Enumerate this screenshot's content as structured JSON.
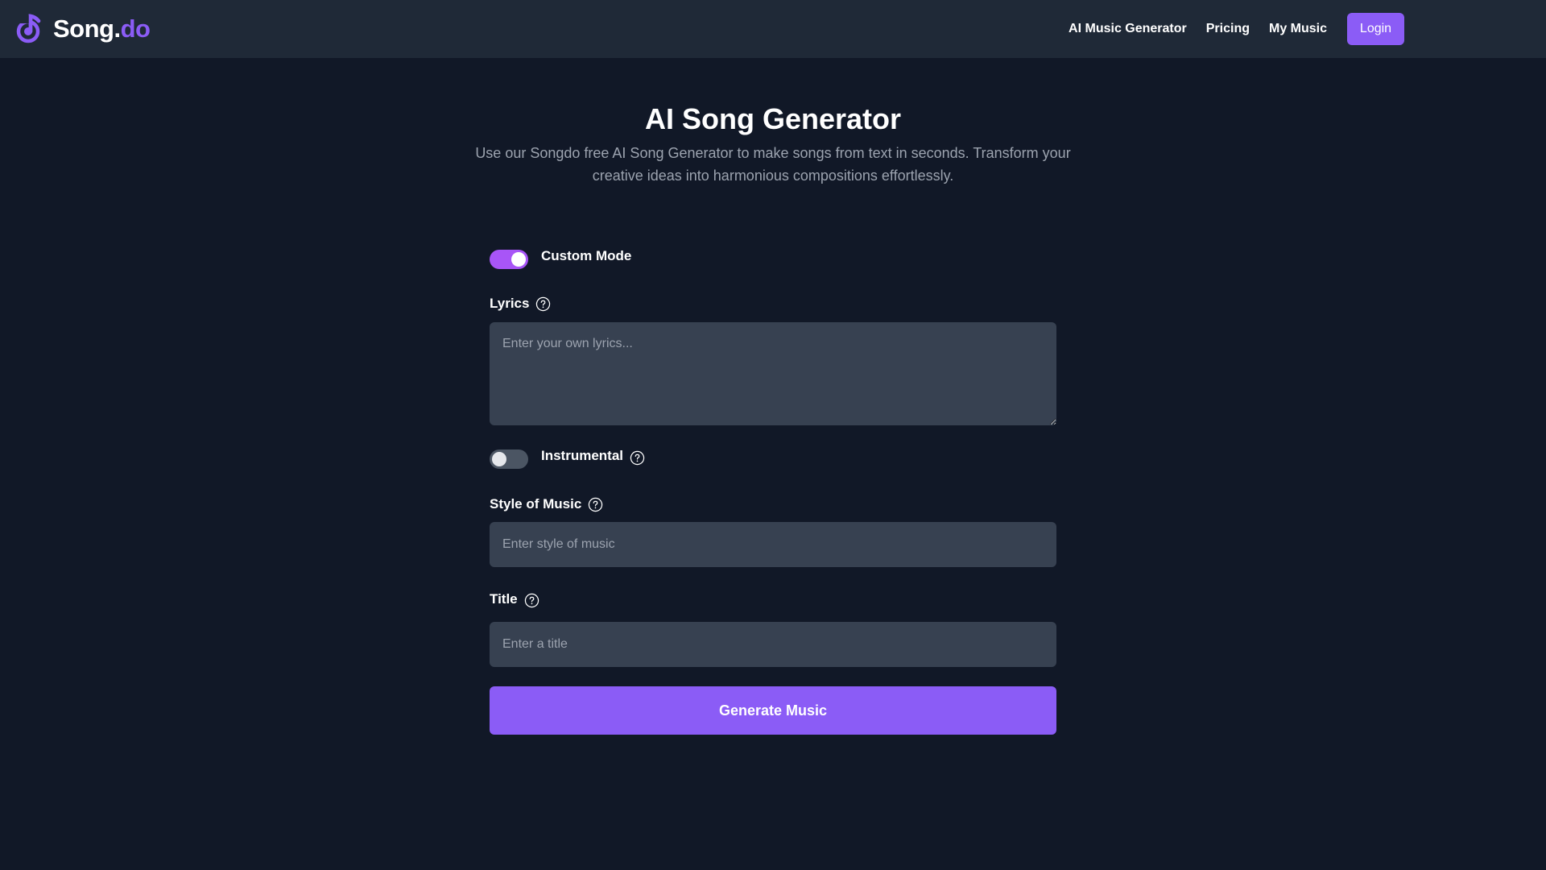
{
  "brand": {
    "name_main": "Song",
    "name_dot": ".",
    "name_suffix": "do",
    "icon": "music-note-icon",
    "accent_color": "#8b5cf6"
  },
  "nav": {
    "items": [
      {
        "label": "AI Music Generator"
      },
      {
        "label": "Pricing"
      },
      {
        "label": "My Music"
      }
    ],
    "login_label": "Login"
  },
  "hero": {
    "title": "AI Song Generator",
    "subtitle": "Use our Songdo free AI Song Generator to make songs from text in seconds. Transform your creative ideas into harmonious compositions effortlessly."
  },
  "form": {
    "custom_mode": {
      "label": "Custom Mode",
      "enabled": true
    },
    "lyrics": {
      "label": "Lyrics",
      "placeholder": "Enter your own lyrics...",
      "value": ""
    },
    "instrumental": {
      "label": "Instrumental",
      "enabled": false
    },
    "style": {
      "label": "Style of Music",
      "placeholder": "Enter style of music",
      "value": ""
    },
    "title": {
      "label": "Title",
      "placeholder": "Enter a title",
      "value": ""
    },
    "submit_label": "Generate Music"
  },
  "colors": {
    "background": "#111827",
    "header": "#1f2937",
    "input": "#374151",
    "accent": "#8b5cf6",
    "toggle_on": "#a855f7"
  }
}
